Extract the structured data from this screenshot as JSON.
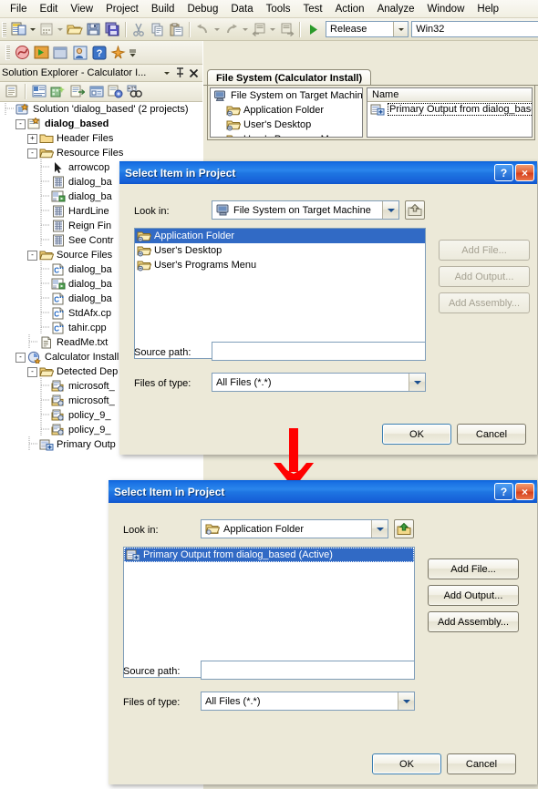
{
  "menubar": {
    "items": [
      "File",
      "Edit",
      "View",
      "Project",
      "Build",
      "Debug",
      "Data",
      "Tools",
      "Test",
      "Action",
      "Analyze",
      "Window",
      "Help"
    ]
  },
  "toolbar": {
    "icons": [
      "new-project-icon",
      "add-item-icon",
      "open-file-icon",
      "save-icon",
      "save-all-icon",
      "cut-icon",
      "copy-icon",
      "paste-icon",
      "undo-icon",
      "redo-icon",
      "navigate-back-icon",
      "navigate-forward-icon",
      "start-debug-icon"
    ],
    "configuration": "Release",
    "platform": "Win32"
  },
  "solution_explorer": {
    "title": "Solution Explorer - Calculator I...",
    "toolbar_icons": [
      "properties-icon",
      "show-all-files-icon",
      "refresh-icon",
      "view-code-icon",
      "view-designer-icon",
      "property-pages-icon",
      "find-icon"
    ],
    "tree": [
      {
        "indent": 0,
        "expander": "",
        "icon": "solution-icon",
        "label": "Solution 'dialog_based' (2 projects)",
        "bold": false
      },
      {
        "indent": 1,
        "expander": "-",
        "icon": "project-icon",
        "label": "dialog_based",
        "bold": true
      },
      {
        "indent": 2,
        "expander": "+",
        "icon": "folder-icon",
        "label": "Header Files",
        "bold": false
      },
      {
        "indent": 2,
        "expander": "-",
        "icon": "folder-open-icon",
        "label": "Resource Files",
        "bold": false
      },
      {
        "indent": 3,
        "expander": "",
        "icon": "cursor-file-icon",
        "label": "arrowcop",
        "bold": false
      },
      {
        "indent": 3,
        "expander": "",
        "icon": "bitmap-file-icon",
        "label": "dialog_ba",
        "bold": false
      },
      {
        "indent": 3,
        "expander": "",
        "icon": "resource-file-icon",
        "label": "dialog_ba",
        "bold": false
      },
      {
        "indent": 3,
        "expander": "",
        "icon": "bitmap-file-icon",
        "label": "HardLine",
        "bold": false
      },
      {
        "indent": 3,
        "expander": "",
        "icon": "bitmap-file-icon",
        "label": "Reign Fin",
        "bold": false
      },
      {
        "indent": 3,
        "expander": "",
        "icon": "bitmap-file-icon",
        "label": "See Contr",
        "bold": false
      },
      {
        "indent": 2,
        "expander": "-",
        "icon": "folder-open-icon",
        "label": "Source Files",
        "bold": false
      },
      {
        "indent": 3,
        "expander": "",
        "icon": "cpp-file-icon",
        "label": "dialog_ba",
        "bold": false
      },
      {
        "indent": 3,
        "expander": "",
        "icon": "resource-file-icon",
        "label": "dialog_ba",
        "bold": false
      },
      {
        "indent": 3,
        "expander": "",
        "icon": "cpp-file-icon",
        "label": "dialog_ba",
        "bold": false
      },
      {
        "indent": 3,
        "expander": "",
        "icon": "cpp-file-icon",
        "label": "StdAfx.cp",
        "bold": false
      },
      {
        "indent": 3,
        "expander": "",
        "icon": "cpp-file-icon",
        "label": "tahir.cpp",
        "bold": false
      },
      {
        "indent": 2,
        "expander": "",
        "icon": "text-file-icon",
        "label": "ReadMe.txt",
        "bold": false
      },
      {
        "indent": 1,
        "expander": "-",
        "icon": "setup-project-icon",
        "label": "Calculator Install",
        "bold": false
      },
      {
        "indent": 2,
        "expander": "-",
        "icon": "folder-open-icon",
        "label": "Detected Dep",
        "bold": false
      },
      {
        "indent": 3,
        "expander": "",
        "icon": "dependency-icon",
        "label": "microsoft_",
        "bold": false
      },
      {
        "indent": 3,
        "expander": "",
        "icon": "dependency-icon",
        "label": "microsoft_",
        "bold": false
      },
      {
        "indent": 3,
        "expander": "",
        "icon": "dependency-icon",
        "label": "policy_9_",
        "bold": false
      },
      {
        "indent": 3,
        "expander": "",
        "icon": "dependency-icon",
        "label": "policy_9_",
        "bold": false
      },
      {
        "indent": 2,
        "expander": "",
        "icon": "primary-output-icon",
        "label": "Primary Outp",
        "bold": false
      }
    ]
  },
  "file_system_editor": {
    "tab_label": "File System (Calculator Install)",
    "tree": [
      {
        "indent": 0,
        "icon": "target-machine-icon",
        "label": "File System on Target Machine"
      },
      {
        "indent": 1,
        "icon": "folder-special-icon",
        "label": "Application Folder"
      },
      {
        "indent": 1,
        "icon": "folder-special-icon",
        "label": "User's Desktop"
      },
      {
        "indent": 1,
        "icon": "folder-special-icon",
        "label": "User's Programs Menu"
      }
    ],
    "column_header": "Name",
    "rows": [
      {
        "icon": "primary-output-icon",
        "label": "Primary Output from dialog_based"
      }
    ]
  },
  "dialog_top": {
    "title": "Select Item in Project",
    "help_glyph": "?",
    "close_glyph": "×",
    "look_in_label": "Look in:",
    "look_in_value": "File System on Target Machine",
    "look_in_icon": "target-machine-icon",
    "up_icon": "up-one-level-icon",
    "list": [
      {
        "icon": "folder-special-icon",
        "label": "Application Folder",
        "selected": true
      },
      {
        "icon": "folder-special-icon",
        "label": "User's Desktop",
        "selected": false
      },
      {
        "icon": "folder-special-icon",
        "label": "User's Programs Menu",
        "selected": false
      }
    ],
    "side_buttons": [
      {
        "label": "Add File...",
        "disabled": true
      },
      {
        "label": "Add Output...",
        "disabled": true
      },
      {
        "label": "Add Assembly...",
        "disabled": true
      }
    ],
    "source_path_label": "Source path:",
    "source_path_value": "",
    "files_of_type_label": "Files of type:",
    "files_of_type_value": "All Files (*.*)",
    "ok_label": "OK",
    "cancel_label": "Cancel"
  },
  "dialog_bottom": {
    "title": "Select Item in Project",
    "help_glyph": "?",
    "close_glyph": "×",
    "look_in_label": "Look in:",
    "look_in_value": "Application Folder",
    "look_in_icon": "folder-special-icon",
    "up_icon": "up-one-level-icon",
    "list": [
      {
        "icon": "primary-output-icon",
        "label": "Primary Output from dialog_based (Active)",
        "selected": true
      }
    ],
    "side_buttons": [
      {
        "label": "Add File...",
        "disabled": false
      },
      {
        "label": "Add Output...",
        "disabled": false
      },
      {
        "label": "Add Assembly...",
        "disabled": false
      }
    ],
    "source_path_label": "Source path:",
    "source_path_value": "",
    "files_of_type_label": "Files of type:",
    "files_of_type_value": "All Files (*.*)",
    "ok_label": "OK",
    "cancel_label": "Cancel"
  },
  "annotation": {
    "arrow_icon": "red-down-arrow",
    "color": "#ff0000"
  },
  "colors": {
    "dialog_face": "#ece9d8",
    "titlebar_blue": "#1e75e2",
    "selection_blue": "#316ac5",
    "accent_red": "#ff0000"
  }
}
